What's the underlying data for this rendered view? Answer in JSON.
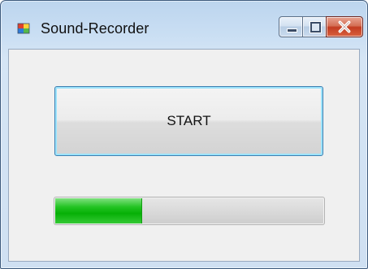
{
  "window": {
    "title": "Sound-Recorder",
    "icons": {
      "app": "app-window-icon",
      "minimize": "minimize-icon",
      "maximize": "maximize-icon",
      "close": "close-icon"
    }
  },
  "main": {
    "start_button_label": "START",
    "progress": {
      "value_fraction": 0.32,
      "fill_color": "#0cb40c"
    }
  },
  "colors": {
    "close_button": "#c94a30",
    "button_border_focus": "#3c7fb1",
    "progress_green": "#0cb40c"
  }
}
